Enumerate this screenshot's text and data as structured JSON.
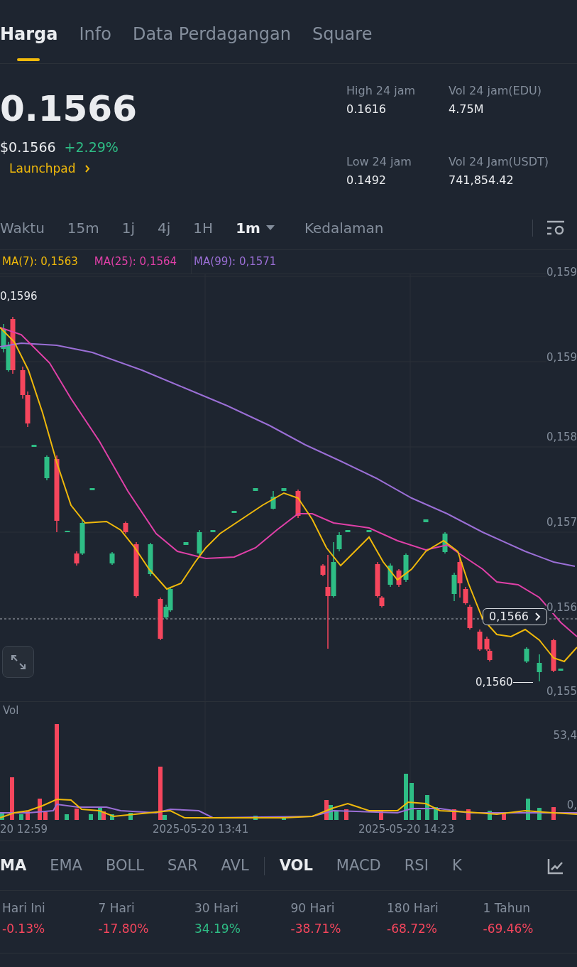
{
  "tabs": [
    {
      "label": "Harga",
      "selected": true
    },
    {
      "label": "Info",
      "selected": false
    },
    {
      "label": "Data Perdagangan",
      "selected": false
    },
    {
      "label": "Square",
      "selected": false
    }
  ],
  "price": {
    "last": "0.1566",
    "usd": "$0.1566",
    "change": "+2.29%",
    "color": "#2ebd85",
    "link": "Launchpad"
  },
  "stats": [
    {
      "label": "High 24 jam",
      "value": "0.1616"
    },
    {
      "label": "Vol 24 jam(EDU)",
      "value": "4.75M"
    },
    {
      "label": "Low 24 jam",
      "value": "0.1492"
    },
    {
      "label": "Vol 24 Jam(USDT)",
      "value": "741,854.42"
    }
  ],
  "intervals": [
    {
      "label": "Waktu",
      "selected": false,
      "menu": false
    },
    {
      "label": "15m",
      "selected": false,
      "menu": false
    },
    {
      "label": "1j",
      "selected": false,
      "menu": false
    },
    {
      "label": "4j",
      "selected": false,
      "menu": false
    },
    {
      "label": "1H",
      "selected": false,
      "menu": false
    },
    {
      "label": "1m",
      "selected": true,
      "menu": true
    },
    {
      "label": "Kedalaman",
      "selected": false,
      "menu": false
    }
  ],
  "legend": [
    {
      "label": "MA(7): 0,1563",
      "color": "#f0b90b"
    },
    {
      "label": "MA(25): 0,1564",
      "color": "#e040a8"
    },
    {
      "label": "MA(99): 0,1571",
      "color": "#9b6fd6"
    }
  ],
  "price_chart": {
    "y_labels": [
      "0,159",
      "0,159",
      "0,158",
      "0,157",
      "0,156",
      "0,155"
    ],
    "high_label": "0,1596",
    "low_label": "0,1560",
    "last_price": "0,1566"
  },
  "volume_chart": {
    "title": "Vol",
    "y_labels": [
      "53,4",
      "0,"
    ]
  },
  "time_labels": [
    "20 12:59",
    "2025-05-20 13:41",
    "2025-05-20 14:23"
  ],
  "indicators": {
    "main": [
      {
        "label": "MA",
        "selected": true
      },
      {
        "label": "EMA",
        "selected": false
      },
      {
        "label": "BOLL",
        "selected": false
      },
      {
        "label": "SAR",
        "selected": false
      },
      {
        "label": "AVL",
        "selected": false
      }
    ],
    "sub": [
      {
        "label": "VOL",
        "selected": true
      },
      {
        "label": "MACD",
        "selected": false
      },
      {
        "label": "RSI",
        "selected": false
      },
      {
        "label": "K",
        "selected": false
      }
    ]
  },
  "performance": [
    {
      "label": "Hari Ini",
      "value": "-0.13%",
      "color": "#f6465d"
    },
    {
      "label": "7 Hari",
      "value": "-17.80%",
      "color": "#f6465d"
    },
    {
      "label": "30 Hari",
      "value": "34.19%",
      "color": "#2ebd85"
    },
    {
      "label": "90 Hari",
      "value": "-38.71%",
      "color": "#f6465d"
    },
    {
      "label": "180 Hari",
      "value": "-68.72%",
      "color": "#f6465d"
    },
    {
      "label": "1 Tahun",
      "value": "-69.46%",
      "color": "#f6465d"
    }
  ]
}
